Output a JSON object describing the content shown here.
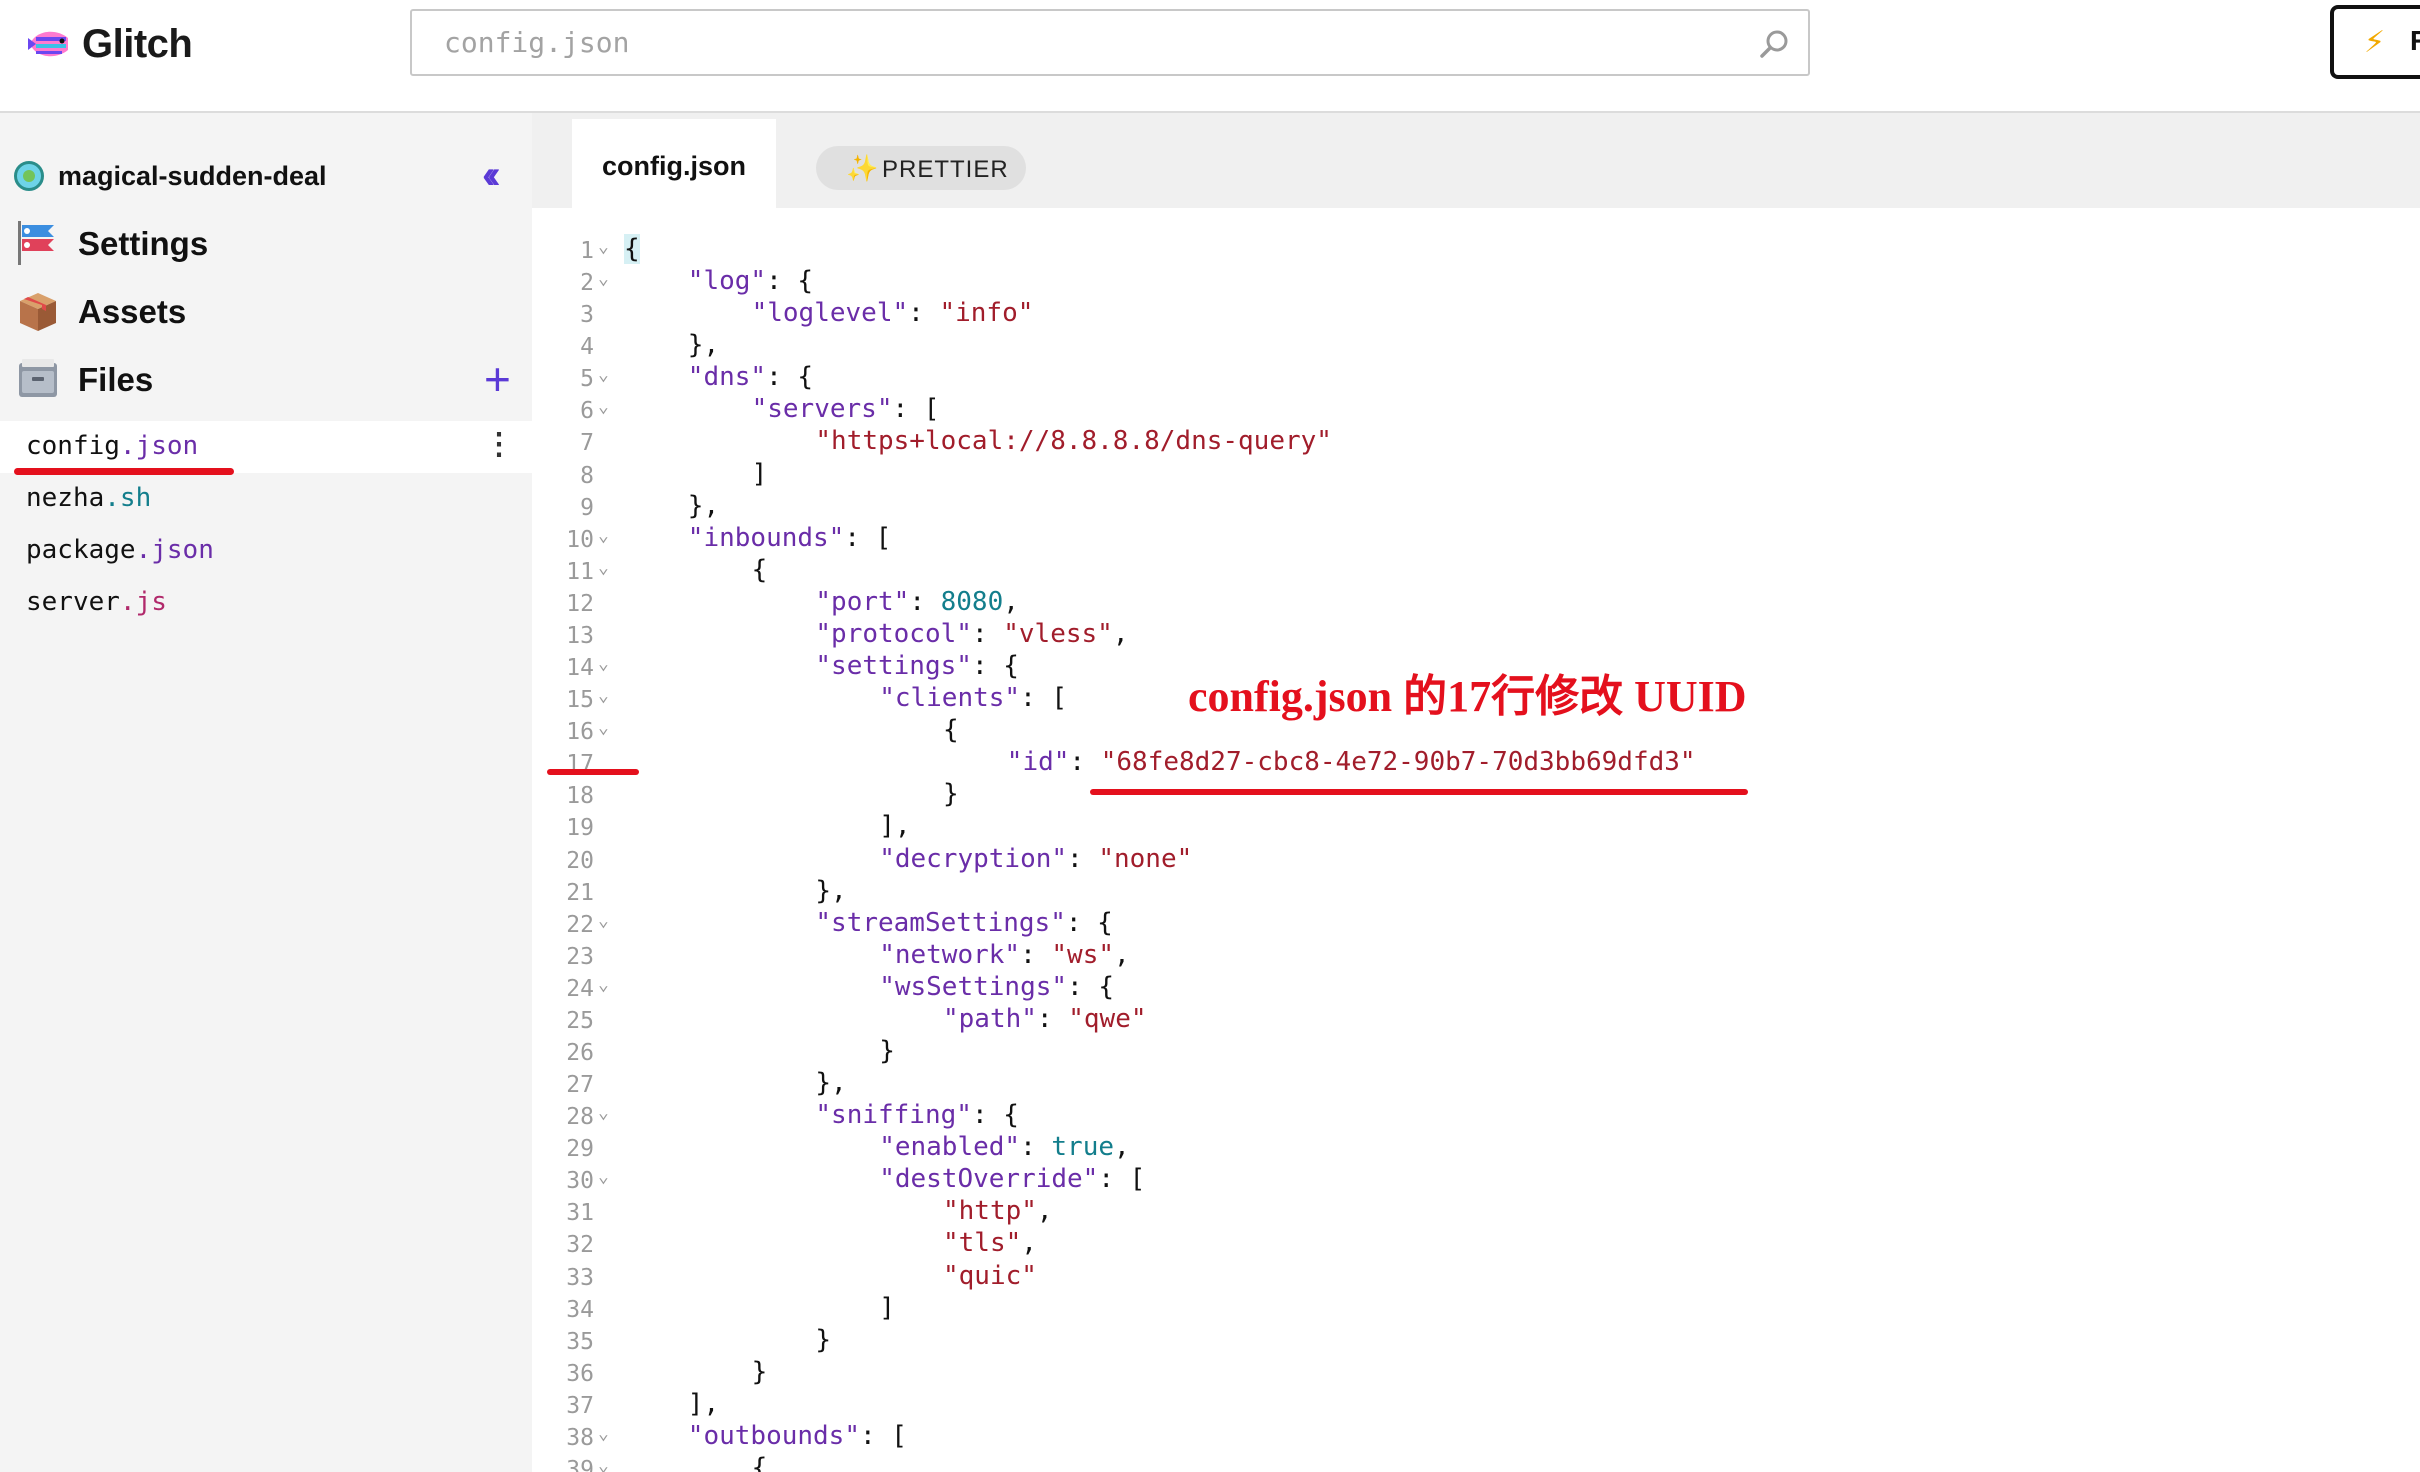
{
  "app": {
    "name": "Glitch"
  },
  "search": {
    "placeholder": "config.json"
  },
  "corner_button": {
    "label": "R"
  },
  "project": {
    "name": "magical-sudden-deal"
  },
  "nav": [
    {
      "label": "Settings",
      "icon": "koinobori-icon"
    },
    {
      "label": "Assets",
      "icon": "package-box-icon"
    },
    {
      "label": "Files",
      "icon": "file-cabinet-icon"
    }
  ],
  "files": [
    {
      "base": "config",
      "ext": ".json",
      "active": true
    },
    {
      "base": "nezha",
      "ext": ".sh",
      "active": false
    },
    {
      "base": "package",
      "ext": ".json",
      "active": false
    },
    {
      "base": "server",
      "ext": ".js",
      "active": false
    }
  ],
  "editor": {
    "active_tab": "config.json",
    "prettier_label": "PRETTIER"
  },
  "annotation": "config.json 的17行修改 UUID",
  "code": {
    "foldable_lines": [
      1,
      2,
      5,
      6,
      10,
      11,
      14,
      15,
      16,
      22,
      24,
      28,
      30,
      38,
      39
    ],
    "lines": [
      [
        [
          "p",
          "{"
        ]
      ],
      [
        [
          "i",
          4
        ],
        [
          "k",
          "\"log\""
        ],
        [
          "p",
          ": {"
        ]
      ],
      [
        [
          "i",
          8
        ],
        [
          "k",
          "\"loglevel\""
        ],
        [
          "p",
          ": "
        ],
        [
          "s",
          "\"info\""
        ]
      ],
      [
        [
          "i",
          4
        ],
        [
          "p",
          "},"
        ]
      ],
      [
        [
          "i",
          4
        ],
        [
          "k",
          "\"dns\""
        ],
        [
          "p",
          ": {"
        ]
      ],
      [
        [
          "i",
          8
        ],
        [
          "k",
          "\"servers\""
        ],
        [
          "p",
          ": ["
        ]
      ],
      [
        [
          "i",
          12
        ],
        [
          "s",
          "\"https+local://8.8.8.8/dns-query\""
        ]
      ],
      [
        [
          "i",
          8
        ],
        [
          "p",
          "]"
        ]
      ],
      [
        [
          "i",
          4
        ],
        [
          "p",
          "},"
        ]
      ],
      [
        [
          "i",
          4
        ],
        [
          "k",
          "\"inbounds\""
        ],
        [
          "p",
          ": ["
        ]
      ],
      [
        [
          "i",
          8
        ],
        [
          "p",
          "{"
        ]
      ],
      [
        [
          "i",
          12
        ],
        [
          "k",
          "\"port\""
        ],
        [
          "p",
          ": "
        ],
        [
          "n",
          "8080"
        ],
        [
          "p",
          ","
        ]
      ],
      [
        [
          "i",
          12
        ],
        [
          "k",
          "\"protocol\""
        ],
        [
          "p",
          ": "
        ],
        [
          "s",
          "\"vless\""
        ],
        [
          "p",
          ","
        ]
      ],
      [
        [
          "i",
          12
        ],
        [
          "k",
          "\"settings\""
        ],
        [
          "p",
          ": {"
        ]
      ],
      [
        [
          "i",
          16
        ],
        [
          "k",
          "\"clients\""
        ],
        [
          "p",
          ": ["
        ]
      ],
      [
        [
          "i",
          20
        ],
        [
          "p",
          "{"
        ]
      ],
      [
        [
          "i",
          24
        ],
        [
          "k",
          "\"id\""
        ],
        [
          "p",
          ": "
        ],
        [
          "s",
          "\"68fe8d27-cbc8-4e72-90b7-70d3bb69dfd3\""
        ]
      ],
      [
        [
          "i",
          20
        ],
        [
          "p",
          "}"
        ]
      ],
      [
        [
          "i",
          16
        ],
        [
          "p",
          "],"
        ]
      ],
      [
        [
          "i",
          16
        ],
        [
          "k",
          "\"decryption\""
        ],
        [
          "p",
          ": "
        ],
        [
          "s",
          "\"none\""
        ]
      ],
      [
        [
          "i",
          12
        ],
        [
          "p",
          "},"
        ]
      ],
      [
        [
          "i",
          12
        ],
        [
          "k",
          "\"streamSettings\""
        ],
        [
          "p",
          ": {"
        ]
      ],
      [
        [
          "i",
          16
        ],
        [
          "k",
          "\"network\""
        ],
        [
          "p",
          ": "
        ],
        [
          "s",
          "\"ws\""
        ],
        [
          "p",
          ","
        ]
      ],
      [
        [
          "i",
          16
        ],
        [
          "k",
          "\"wsSettings\""
        ],
        [
          "p",
          ": {"
        ]
      ],
      [
        [
          "i",
          20
        ],
        [
          "k",
          "\"path\""
        ],
        [
          "p",
          ": "
        ],
        [
          "s",
          "\"qwe\""
        ]
      ],
      [
        [
          "i",
          16
        ],
        [
          "p",
          "}"
        ]
      ],
      [
        [
          "i",
          12
        ],
        [
          "p",
          "},"
        ]
      ],
      [
        [
          "i",
          12
        ],
        [
          "k",
          "\"sniffing\""
        ],
        [
          "p",
          ": {"
        ]
      ],
      [
        [
          "i",
          16
        ],
        [
          "k",
          "\"enabled\""
        ],
        [
          "p",
          ": "
        ],
        [
          "n",
          "true"
        ],
        [
          "p",
          ","
        ]
      ],
      [
        [
          "i",
          16
        ],
        [
          "k",
          "\"destOverride\""
        ],
        [
          "p",
          ": ["
        ]
      ],
      [
        [
          "i",
          20
        ],
        [
          "s",
          "\"http\""
        ],
        [
          "p",
          ","
        ]
      ],
      [
        [
          "i",
          20
        ],
        [
          "s",
          "\"tls\""
        ],
        [
          "p",
          ","
        ]
      ],
      [
        [
          "i",
          20
        ],
        [
          "s",
          "\"quic\""
        ]
      ],
      [
        [
          "i",
          16
        ],
        [
          "p",
          "]"
        ]
      ],
      [
        [
          "i",
          12
        ],
        [
          "p",
          "}"
        ]
      ],
      [
        [
          "i",
          8
        ],
        [
          "p",
          "}"
        ]
      ],
      [
        [
          "i",
          4
        ],
        [
          "p",
          "],"
        ]
      ],
      [
        [
          "i",
          4
        ],
        [
          "k",
          "\"outbounds\""
        ],
        [
          "p",
          ": ["
        ]
      ],
      [
        [
          "i",
          8
        ],
        [
          "p",
          "{"
        ]
      ]
    ]
  },
  "colors": {
    "accent": "#5b3ad6",
    "annotation_red": "#e4101d",
    "json_key": "#6a2da8",
    "json_string": "#a11d2b",
    "json_number": "#137e8c"
  }
}
